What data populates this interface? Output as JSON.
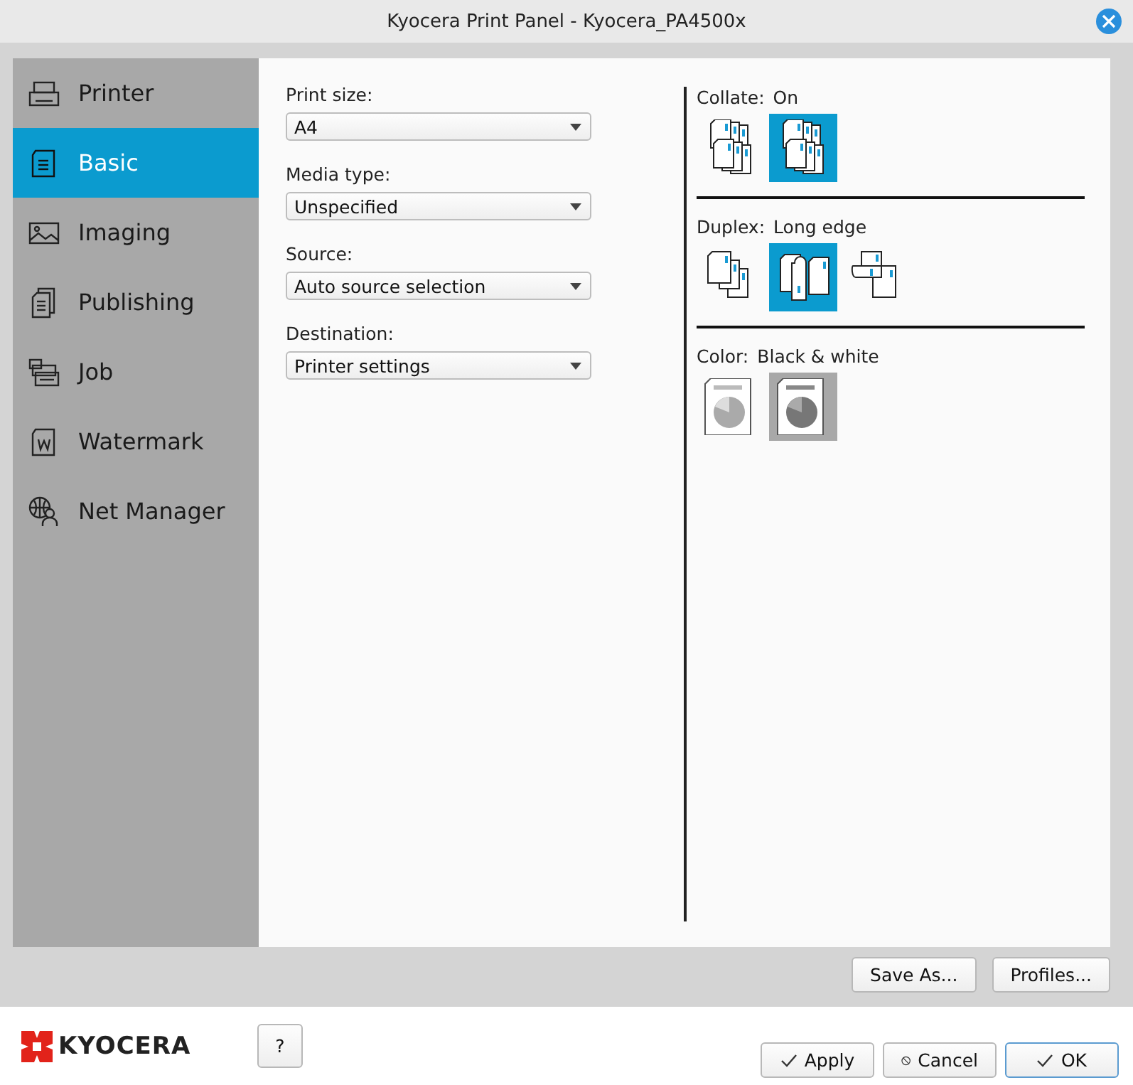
{
  "window": {
    "title": "Kyocera Print Panel - Kyocera_PA4500x"
  },
  "sidebar": {
    "items": [
      {
        "label": "Printer",
        "kind": "printer",
        "selected": false
      },
      {
        "label": "Basic",
        "kind": "document",
        "selected": true
      },
      {
        "label": "Imaging",
        "kind": "image",
        "selected": false
      },
      {
        "label": "Publishing",
        "kind": "pages",
        "selected": false
      },
      {
        "label": "Job",
        "kind": "job",
        "selected": false
      },
      {
        "label": "Watermark",
        "kind": "watermark",
        "selected": false
      },
      {
        "label": "Net Manager",
        "kind": "net",
        "selected": false
      }
    ]
  },
  "fields": [
    {
      "label": "Print size:",
      "value": "A4"
    },
    {
      "label": "Media type:",
      "value": "Unspecified"
    },
    {
      "label": "Source:",
      "value": "Auto source selection"
    },
    {
      "label": "Destination:",
      "value": "Printer settings"
    }
  ],
  "groups": [
    {
      "kind": "collate",
      "label": "Collate:",
      "value": "On",
      "options": [
        {
          "selected": false
        },
        {
          "selected": true
        }
      ]
    },
    {
      "kind": "duplex",
      "label": "Duplex:",
      "value": "Long edge",
      "options": [
        {
          "selected": false
        },
        {
          "selected": true
        },
        {
          "selected": false
        }
      ]
    },
    {
      "kind": "color",
      "label": "Color:",
      "value": "Black & white",
      "options": [
        {
          "selected": false
        },
        {
          "selected": true
        }
      ]
    }
  ],
  "profile_buttons": [
    "Save As...",
    "Profiles..."
  ],
  "help_button": "?",
  "logo": "KYOCERA",
  "dialog_buttons": [
    {
      "kind": "apply",
      "label": "Apply"
    },
    {
      "kind": "cancel",
      "label": "Cancel"
    },
    {
      "kind": "ok",
      "label": "OK"
    }
  ]
}
